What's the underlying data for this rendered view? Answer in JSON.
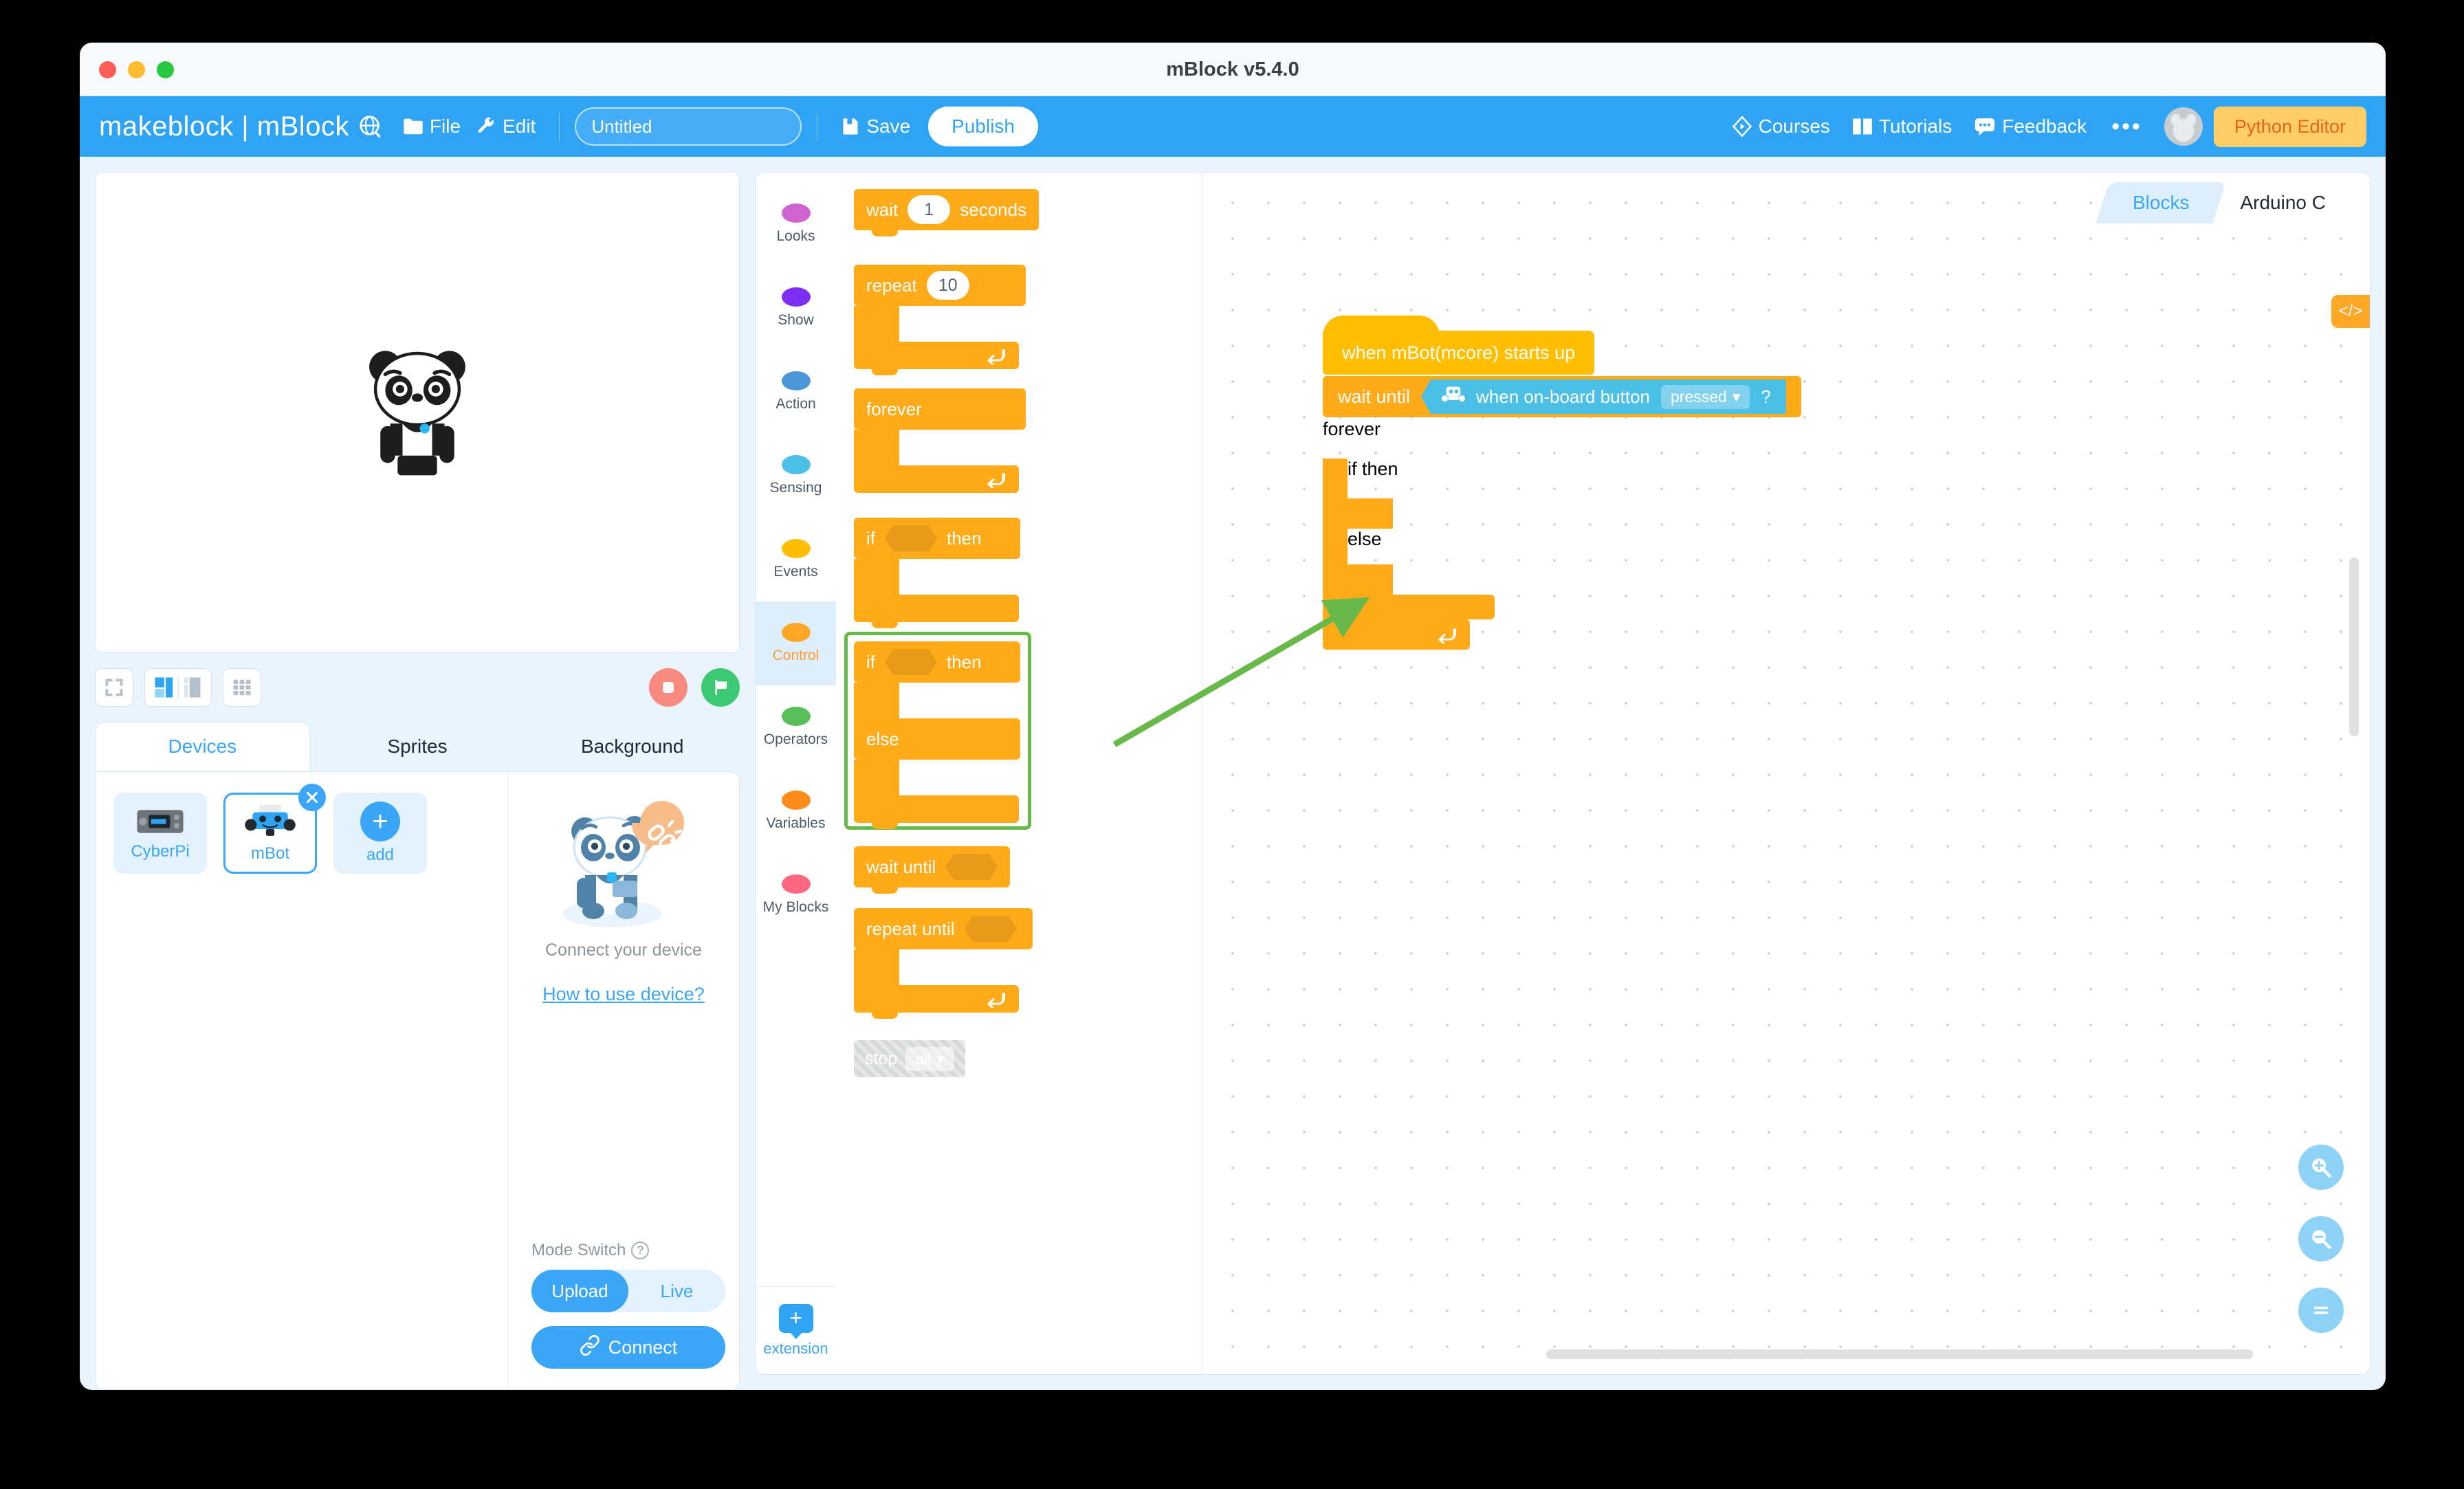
{
  "window": {
    "title": "mBlock v5.4.0"
  },
  "toolbar": {
    "brand": "makeblock | mBlock",
    "globe_icon": "globe-language-icon",
    "file_label": "File",
    "edit_label": "Edit",
    "project_name": "Untitled",
    "project_placeholder": "Untitled",
    "save_label": "Save",
    "publish_label": "Publish",
    "courses_label": "Courses",
    "tutorials_label": "Tutorials",
    "feedback_label": "Feedback",
    "more_label": "•••",
    "python_editor_label": "Python Editor",
    "accent": "#2fa4f5",
    "python_btn_bg": "#ffce67",
    "python_btn_color": "#e8621a"
  },
  "stage": {
    "sprite": "panda-sprite",
    "controls": {
      "fullscreen": "fullscreen-icon",
      "layout_split": "layout-split-icon",
      "layout_small": "layout-small-stage-icon",
      "grid": "grid-layout-icon",
      "stop": "stop-button",
      "flag": "green-flag-button",
      "stop_color": "#F98A80",
      "flag_color": "#3BC973"
    }
  },
  "panel": {
    "tabs": [
      {
        "label": "Devices",
        "active": true
      },
      {
        "label": "Sprites",
        "active": false
      },
      {
        "label": "Background",
        "active": false
      }
    ],
    "devices": [
      {
        "label": "CyberPi",
        "selected": false
      },
      {
        "label": "mBot",
        "selected": true
      },
      {
        "label": "add",
        "selected": false
      }
    ],
    "connect": {
      "mascot": "panda-connect-illustration",
      "text": "Connect your device",
      "link": "How to use device?",
      "mode_label": "Mode Switch",
      "mode_options": [
        "Upload",
        "Live"
      ],
      "mode_selected": "Upload",
      "connect_label": "Connect"
    }
  },
  "palette": {
    "categories": [
      {
        "label": "Looks",
        "color": "#CF63CF",
        "active": false
      },
      {
        "label": "Show",
        "color": "#7B2FF2",
        "active": false
      },
      {
        "label": "Action",
        "color": "#4C97D8",
        "active": false
      },
      {
        "label": "Sensing",
        "color": "#4CBFE6",
        "active": false
      },
      {
        "label": "Events",
        "color": "#FFBF00",
        "active": false
      },
      {
        "label": "Control",
        "color": "#FFA726",
        "active": true
      },
      {
        "label": "Operators",
        "color": "#59C059",
        "active": false
      },
      {
        "label": "Variables",
        "color": "#FF8C1A",
        "active": false
      },
      {
        "label": "My Blocks",
        "color": "#FF6680",
        "active": false
      }
    ],
    "extension": {
      "label": "extension",
      "icon": "add-extension-icon"
    },
    "blocks": {
      "wait_label": "wait",
      "wait_value": "1",
      "wait_unit": "seconds",
      "repeat_label": "repeat",
      "repeat_value": "10",
      "forever_label": "forever",
      "if_label": "if",
      "then_label": "then",
      "else_label": "else",
      "wait_until_label": "wait until",
      "repeat_until_label": "repeat until",
      "stop_label": "stop",
      "stop_option": "all"
    },
    "highlight_color": "#69b94a"
  },
  "canvas": {
    "tabs": [
      {
        "label": "Blocks",
        "active": true
      },
      {
        "label": "Arduino C",
        "active": false
      }
    ],
    "code_toggle": "code-view-icon",
    "zoom_in": "zoom-in-icon",
    "zoom_out": "zoom-out-icon",
    "zoom_reset": "zoom-reset-icon",
    "script": {
      "hat_label": "when mBot(mcore) starts up",
      "wait_until_label": "wait until",
      "sensing_block_icon": "mbot-robot-icon",
      "sensing_block_label": "when on-board button",
      "sensing_dropdown": "pressed",
      "sensing_question": "?",
      "forever_label": "forever",
      "if_label": "if",
      "then_label": "then",
      "else_label": "else"
    },
    "annotation": {
      "type": "arrow",
      "color": "#69b94a"
    }
  }
}
